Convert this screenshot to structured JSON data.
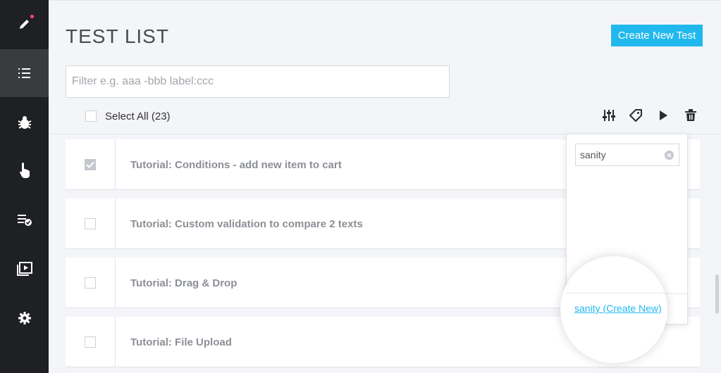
{
  "sidebar": {
    "items": [
      {
        "icon": "pencil-icon",
        "active": false
      },
      {
        "icon": "list-icon",
        "active": true
      },
      {
        "icon": "bug-icon",
        "active": false
      },
      {
        "icon": "hand-pointer-icon",
        "active": false
      },
      {
        "icon": "checklist-icon",
        "active": false
      },
      {
        "icon": "play-screen-icon",
        "active": false
      },
      {
        "icon": "gear-icon",
        "active": false
      }
    ],
    "notification_color": "#ff4d74"
  },
  "header": {
    "title": "TEST LIST",
    "create_button_label": "Create New Test"
  },
  "filter": {
    "placeholder": "Filter e.g. aaa -bbb label:ccc",
    "value": ""
  },
  "select_all": {
    "label": "Select All (23)"
  },
  "toolbar": {
    "icons": [
      "sliders-icon",
      "tag-icon",
      "play-icon",
      "trash-icon"
    ]
  },
  "tests": [
    {
      "name": "Tutorial: Conditions - add new item to cart",
      "checked": true
    },
    {
      "name": "Tutorial: Custom validation to compare 2 texts",
      "checked": false
    },
    {
      "name": "Tutorial: Drag & Drop",
      "checked": false
    },
    {
      "name": "Tutorial: File Upload",
      "checked": false
    }
  ],
  "label_popup": {
    "search_value": "sanity",
    "create_link": "sanity (Create New)"
  },
  "colors": {
    "accent": "#21b8ee",
    "sidebar_bg": "#1f2023",
    "page_bg": "#f4f5f8"
  }
}
